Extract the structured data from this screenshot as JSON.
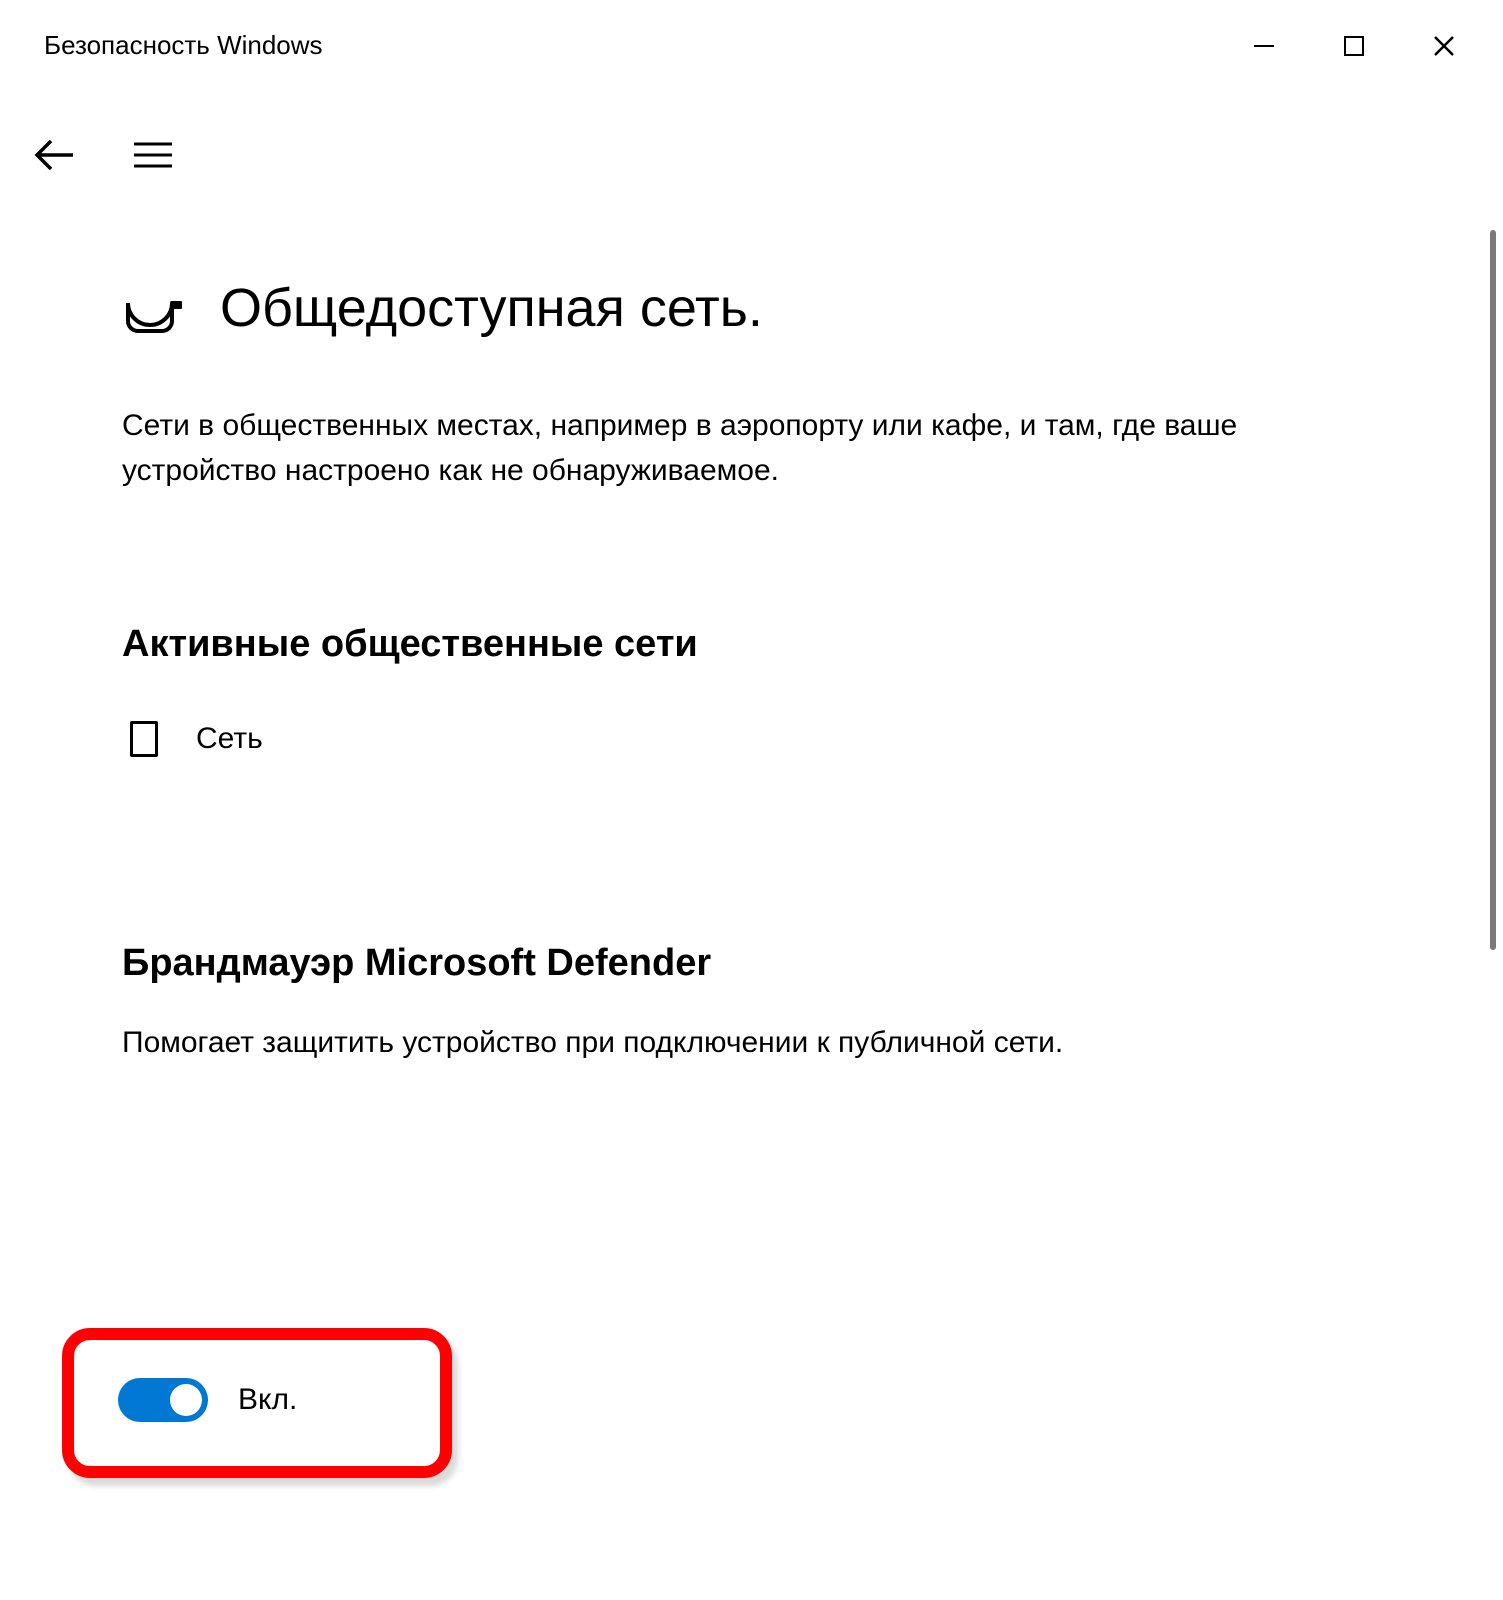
{
  "window": {
    "title": "Безопасность Windows"
  },
  "page": {
    "title": "Общедоступная сеть.",
    "description": "Сети в общественных местах, например в аэропорту или кафе, и там, где ваше устройство настроено как не обнаруживаемое."
  },
  "sections": {
    "active_networks": {
      "heading": "Активные общественные сети",
      "network_name": "Сеть"
    },
    "firewall": {
      "heading": "Брандмауэр Microsoft Defender",
      "description": "Помогает защитить устройство при подключении к публичной сети.",
      "toggle_label": "Вкл.",
      "toggle_state": "on"
    }
  }
}
